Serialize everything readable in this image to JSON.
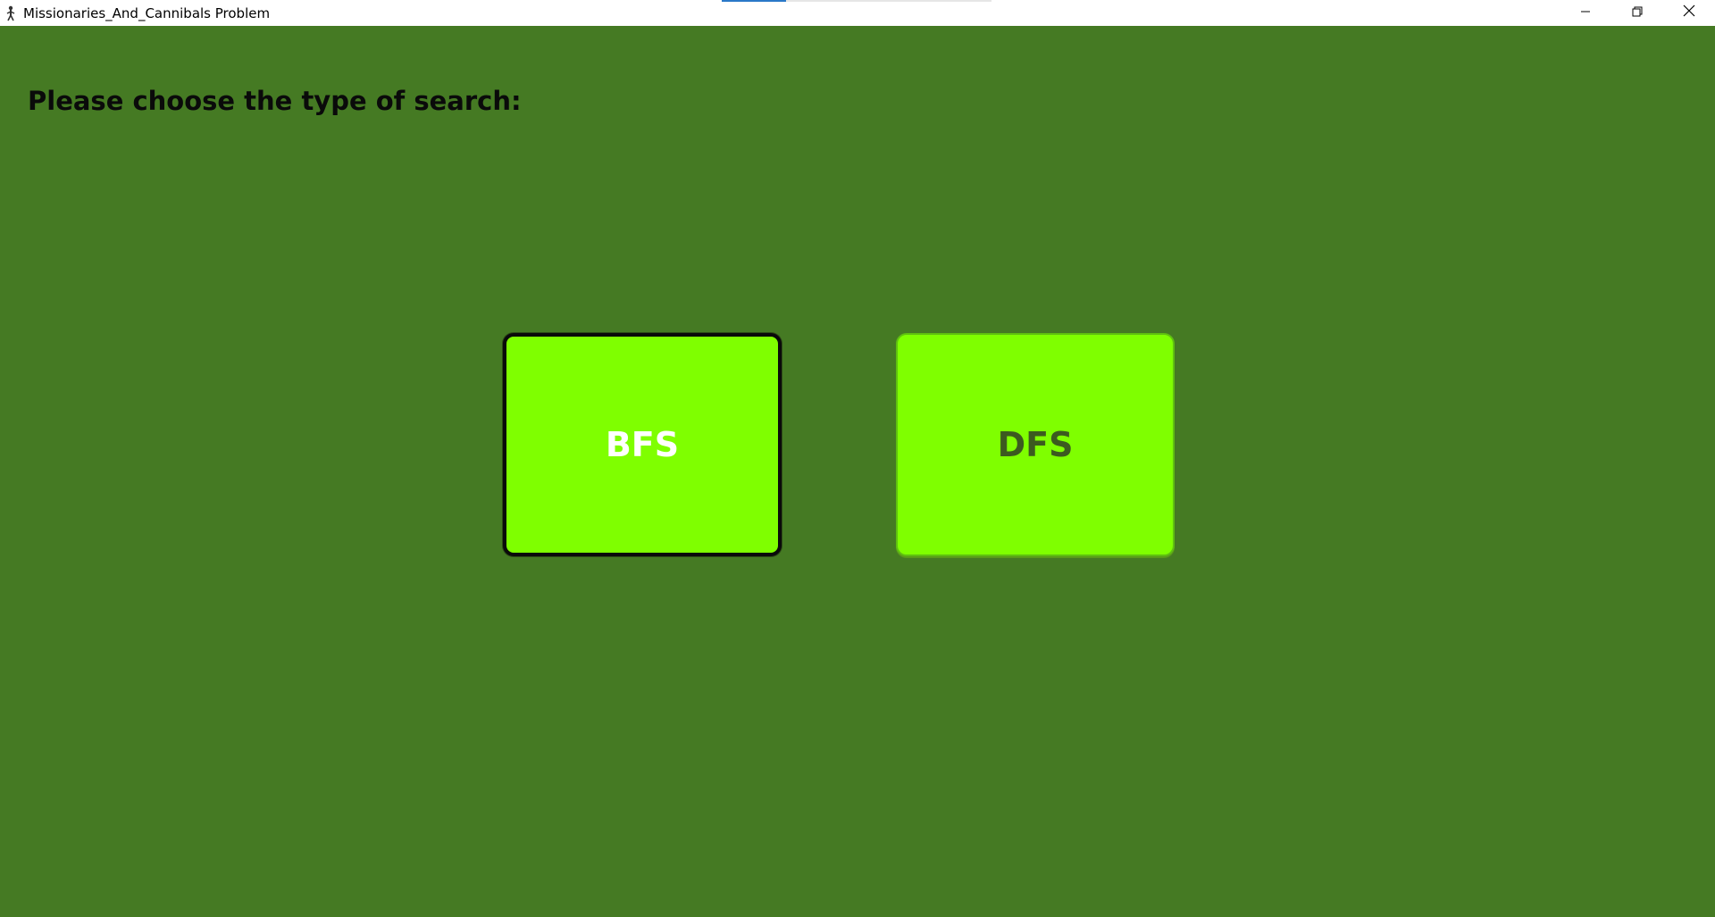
{
  "window": {
    "title": "Missionaries_And_Cannibals Problem",
    "background_color": "#457a23",
    "app_icon": "stick-figure-icon",
    "loading_progress": 0.24,
    "controls": {
      "minimize_icon": "minimize-icon",
      "maximize_icon": "restore-icon",
      "close_icon": "close-icon"
    }
  },
  "main": {
    "heading": "Please choose the type of search:",
    "buttons": [
      {
        "label": "BFS",
        "color": "#7fff00",
        "text_color": "#ffffff",
        "focused": true
      },
      {
        "label": "DFS",
        "color": "#7fff00",
        "text_color": "#3c5a20",
        "focused": false
      }
    ]
  }
}
